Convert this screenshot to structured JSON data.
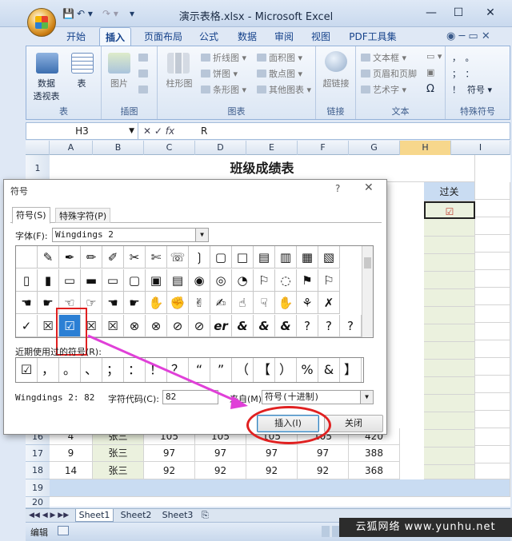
{
  "window": {
    "title": "演示表格.xlsx - Microsoft Excel",
    "controls": [
      "minimize",
      "maximize",
      "close"
    ]
  },
  "ribbon_tabs": [
    "开始",
    "插入",
    "页面布局",
    "公式",
    "数据",
    "审阅",
    "视图",
    "PDF工具集"
  ],
  "active_tab": "插入",
  "ribbon_groups": [
    {
      "label": "表",
      "buttons": [
        "数据\n透视表",
        "表"
      ]
    },
    {
      "label": "插图",
      "buttons": [
        "图片"
      ]
    },
    {
      "label": "图表",
      "buttons": [
        "柱形图"
      ],
      "small": [
        "折线图",
        "饼图",
        "条形图",
        "面积图",
        "散点图",
        "其他图表"
      ]
    },
    {
      "label": "链接",
      "buttons": [
        "超链接"
      ]
    },
    {
      "label": "文本",
      "small": [
        "文本框",
        "页眉和页脚",
        "艺术字"
      ]
    },
    {
      "label": "特殊符号",
      "small": [
        "符号"
      ]
    }
  ],
  "formula_bar": {
    "name_box": "H3",
    "fx": "fx",
    "content": "R"
  },
  "columns": [
    "A",
    "B",
    "C",
    "D",
    "E",
    "F",
    "G",
    "H",
    "I"
  ],
  "sheet": {
    "title": "班级成绩表",
    "header_h": "过关",
    "h_checkbox": "☑",
    "rows": [
      {
        "num": "1",
        "cells": []
      },
      {
        "num": "16",
        "cells": [
          "4",
          "张三",
          "105",
          "105",
          "105",
          "105",
          "420"
        ]
      },
      {
        "num": "17",
        "cells": [
          "9",
          "张三",
          "97",
          "97",
          "97",
          "97",
          "388"
        ]
      },
      {
        "num": "18",
        "cells": [
          "14",
          "张三",
          "92",
          "92",
          "92",
          "92",
          "368"
        ]
      },
      {
        "num": "19",
        "cells": []
      },
      {
        "num": "20",
        "cells": []
      }
    ]
  },
  "sheet_tabs": [
    "Sheet1",
    "Sheet2",
    "Sheet3"
  ],
  "status": {
    "mode": "编辑"
  },
  "watermark": "云狐网络 www.yunhu.net",
  "dialog": {
    "title": "符号",
    "tabs": [
      "符号(S)",
      "特殊字符(P)"
    ],
    "font_label": "字体(F):",
    "font_value": "Wingdings 2",
    "grid": [
      [
        "",
        "✎",
        "✒",
        "✏",
        "✐",
        "✂",
        "✄",
        "☏",
        "❳",
        "▢",
        "□",
        "▤",
        "▥",
        "▦",
        "▧"
      ],
      [
        "▯",
        "▮",
        "▭",
        "▬",
        "▭",
        "▢",
        "▣",
        "▤",
        "◉",
        "◎",
        "◔",
        "⚐",
        "◌",
        "⚑",
        "⚐"
      ],
      [
        "☚",
        "☛",
        "☜",
        "☞",
        "☚",
        "☛",
        "✋",
        "✊",
        "✌",
        "✍",
        "☝",
        "☟",
        "✋",
        "⚘",
        "✗"
      ],
      [
        "✓",
        "☒",
        "☑",
        "☒",
        "☒",
        "⊗",
        "⊗",
        "⊘",
        "⊘",
        "er",
        "&",
        "&",
        "&",
        "?",
        "?",
        "?"
      ]
    ],
    "selected_symbol": "☑",
    "recent_label": "近期使用过的符号(R):",
    "recent": [
      "☑",
      "，",
      "。",
      "、",
      "；",
      "：",
      "！",
      "？",
      "“",
      "”",
      "（",
      "【",
      "）",
      "%",
      "&",
      "】"
    ],
    "font_info": "Wingdings 2: 82",
    "charcode_label": "字符代码(C):",
    "charcode_value": "82",
    "from_label": "来自(M):",
    "from_value": "符号(十进制)",
    "insert_button": "插入(I)",
    "close_button": "关闭"
  }
}
